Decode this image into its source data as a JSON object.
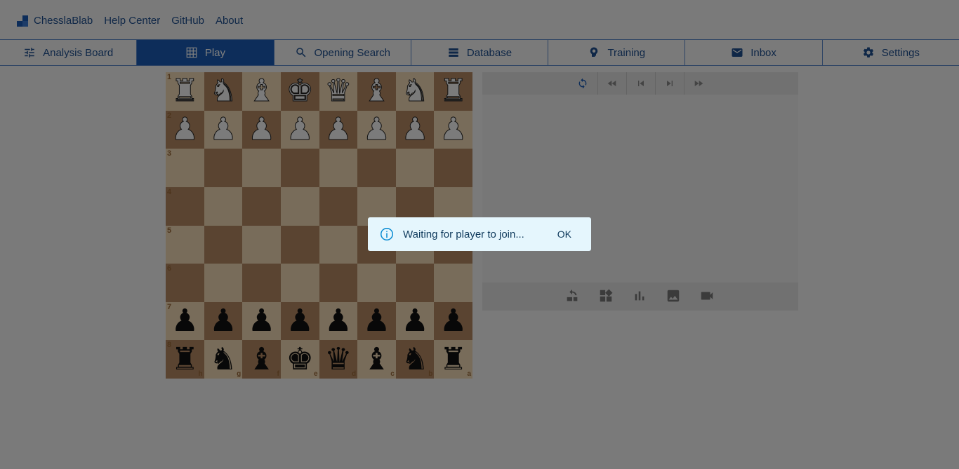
{
  "brand": {
    "name": "ChesslaBlab"
  },
  "toplinks": [
    "Help Center",
    "GitHub",
    "About"
  ],
  "nav": [
    {
      "label": "Analysis Board",
      "icon": "sliders-icon"
    },
    {
      "label": "Play",
      "icon": "board-icon",
      "active": true
    },
    {
      "label": "Opening Search",
      "icon": "search-icon"
    },
    {
      "label": "Database",
      "icon": "database-icon"
    },
    {
      "label": "Training",
      "icon": "training-icon"
    },
    {
      "label": "Inbox",
      "icon": "mail-icon"
    },
    {
      "label": "Settings",
      "icon": "gear-icon"
    }
  ],
  "board": {
    "rank_labels": [
      "1",
      "2",
      "3",
      "4",
      "5",
      "6",
      "7",
      "8"
    ],
    "file_labels": [
      "h",
      "g",
      "f",
      "e",
      "d",
      "c",
      "b",
      "a"
    ],
    "rows": [
      [
        "wr",
        "wn",
        "wb",
        "wk",
        "wq",
        "wb",
        "wn",
        "wr"
      ],
      [
        "wp",
        "wp",
        "wp",
        "wp",
        "wp",
        "wp",
        "wp",
        "wp"
      ],
      [
        "",
        "",
        "",
        "",
        "",
        "",
        "",
        ""
      ],
      [
        "",
        "",
        "",
        "",
        "",
        "",
        "",
        ""
      ],
      [
        "",
        "",
        "",
        "",
        "",
        "",
        "",
        ""
      ],
      [
        "",
        "",
        "",
        "",
        "",
        "",
        "",
        ""
      ],
      [
        "bp",
        "bp",
        "bp",
        "bp",
        "bp",
        "bp",
        "bp",
        "bp"
      ],
      [
        "br",
        "bn",
        "bb",
        "bk",
        "bq",
        "bb",
        "bn",
        "br"
      ]
    ],
    "colors": {
      "light": "#f1d9b5",
      "dark": "#b58863"
    }
  },
  "panel": {
    "controls": [
      "flip-icon",
      "fast-back-icon",
      "prev-icon",
      "next-icon",
      "fast-forward-icon"
    ],
    "tools": [
      "swap-icon",
      "widgets-icon",
      "bar-chart-icon",
      "image-icon",
      "video-icon"
    ]
  },
  "dialog": {
    "message": "Waiting for player to join...",
    "ok_label": "OK"
  },
  "colors": {
    "accent": "#1a5bb5"
  }
}
